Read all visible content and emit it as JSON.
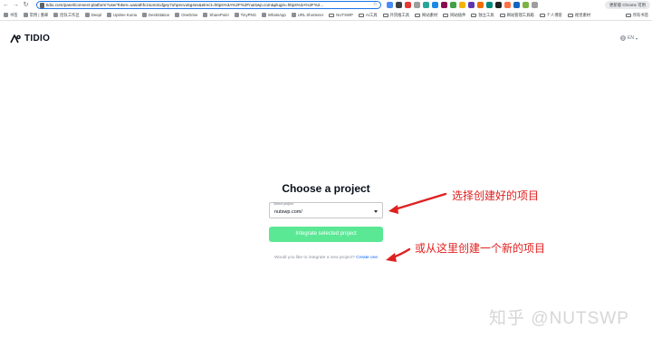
{
  "browser": {
    "url": "tidio.com/panel/connect-platform?userToken=uasathfc1sum3cdgey7uhpecvu5g4ex&elrect=https%3A%2F%2Fnutswp.com&plugin=https%3A%2F%2...",
    "account_button": "更新版 Chrome 可用"
  },
  "bookmarks": {
    "items": [
      {
        "label": "书签",
        "icon": "bookmark-icon"
      },
      {
        "label": "常用 | 重邮",
        "icon": "site-icon"
      },
      {
        "label": "团队工作区",
        "icon": "site-icon"
      },
      {
        "label": "Deepl",
        "icon": "site-icon"
      },
      {
        "label": "Uptime Kuma",
        "icon": "site-icon"
      },
      {
        "label": "DeskStation",
        "icon": "site-icon"
      },
      {
        "label": "OneDrive",
        "icon": "cloud-icon"
      },
      {
        "label": "SharePoint",
        "icon": "site-icon"
      },
      {
        "label": "TinyPNG",
        "icon": "site-icon"
      },
      {
        "label": "WhatsApp",
        "icon": "site-icon"
      },
      {
        "label": "URL Shortener",
        "icon": "site-icon"
      },
      {
        "label": "NUTSWP",
        "icon": "folder-icon"
      },
      {
        "label": "AI工具",
        "icon": "folder-icon"
      },
      {
        "label": "外贸推工具",
        "icon": "folder-icon"
      },
      {
        "label": "网站素材",
        "icon": "folder-icon"
      },
      {
        "label": "网站插件",
        "icon": "folder-icon"
      },
      {
        "label": "独立工具",
        "icon": "folder-icon"
      },
      {
        "label": "网站管理工具箱",
        "icon": "folder-icon"
      },
      {
        "label": "个人博客",
        "icon": "folder-icon"
      },
      {
        "label": "视觉素材",
        "icon": "folder-icon"
      }
    ],
    "more_label": "所有书签"
  },
  "header": {
    "logo_text": "TIDIO",
    "language": "EN"
  },
  "main": {
    "title": "Choose a project",
    "select_label": "Select project",
    "select_value": "nutswp.com/",
    "integrate_button": "Integrate selected project",
    "help_text": "Would you like to integrate a new project?",
    "create_link": "Create one"
  },
  "annotations": {
    "select_hint": "选择创建好的项目",
    "create_hint": "或从这里创建一个新的项目",
    "color": "#e02020"
  },
  "watermark": "知乎 @NUTSWP",
  "colors": {
    "accent_green": "#5ae895",
    "link_blue": "#0566ff",
    "url_focus": "#1a73e8"
  }
}
